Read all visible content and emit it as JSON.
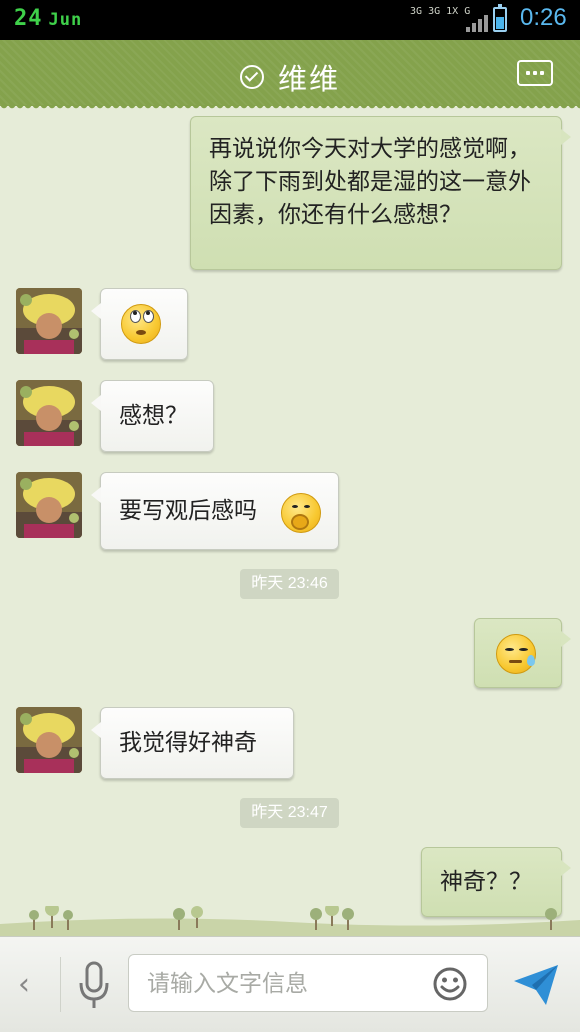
{
  "status_bar": {
    "date_day": "24",
    "date_month": "Jun",
    "net_labels": [
      "3G",
      "3G",
      "1X",
      "G"
    ],
    "time": "0:26"
  },
  "header": {
    "title": "维维",
    "verified_icon": "check-circle-icon",
    "more_icon": "more-icon"
  },
  "messages": [
    {
      "dir": "out",
      "text": "再说说你今天对大学的感觉啊，除了下雨到处都是湿的这一意外因素，你还有什么感想？"
    },
    {
      "dir": "in",
      "emoji": "rolling-eyes-emoji"
    },
    {
      "dir": "in",
      "text": "感想？"
    },
    {
      "dir": "in",
      "text": "要写观后感吗",
      "emoji": "shy-emoji"
    },
    {
      "dir": "time",
      "text": "昨天 23:46"
    },
    {
      "dir": "out",
      "emoji": "sweat-emoji"
    },
    {
      "dir": "in",
      "text": "我觉得好神奇"
    },
    {
      "dir": "time",
      "text": "昨天 23:47"
    },
    {
      "dir": "out",
      "text": "神奇？？"
    }
  ],
  "input_bar": {
    "back_icon": "chevron-left-icon",
    "mic_icon": "microphone-icon",
    "placeholder": "请输入文字信息",
    "emoji_icon": "smiley-icon",
    "send_icon": "send-plane-icon"
  },
  "colors": {
    "header_green": "#84a24c",
    "chat_background": "#e6ecd8",
    "outgoing_bubble": "#d4e2b8",
    "incoming_bubble": "#f6f6f4",
    "time_color": "#5ab8ee",
    "send_icon": "#2f8fd6"
  }
}
